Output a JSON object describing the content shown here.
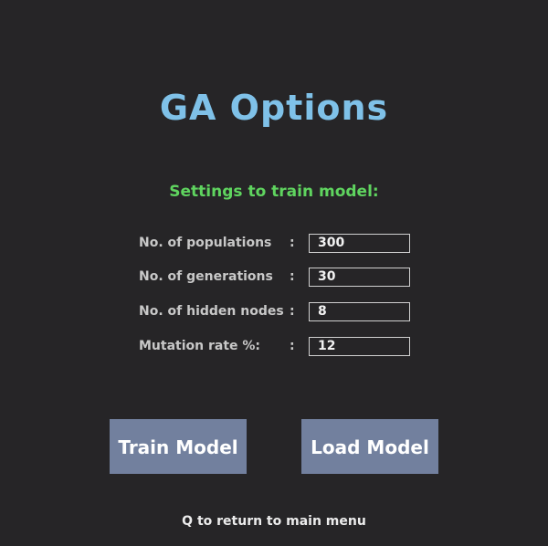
{
  "title": "GA Options",
  "subtitle": "Settings to train model:",
  "settings": [
    {
      "label": "No. of populations",
      "colon": ":",
      "value": "300"
    },
    {
      "label": "No. of generations",
      "colon": ":",
      "value": "30"
    },
    {
      "label": "No. of hidden nodes",
      "colon": ":",
      "value": "8"
    },
    {
      "label": "Mutation rate %:",
      "colon": ":",
      "value": "12"
    }
  ],
  "buttons": {
    "train": "Train Model",
    "load": "Load Model"
  },
  "footer": "Q to return to main menu",
  "colors": {
    "background": "#262527",
    "title": "#7fc1e8",
    "subtitle": "#5fd45f",
    "button": "#72809e"
  }
}
